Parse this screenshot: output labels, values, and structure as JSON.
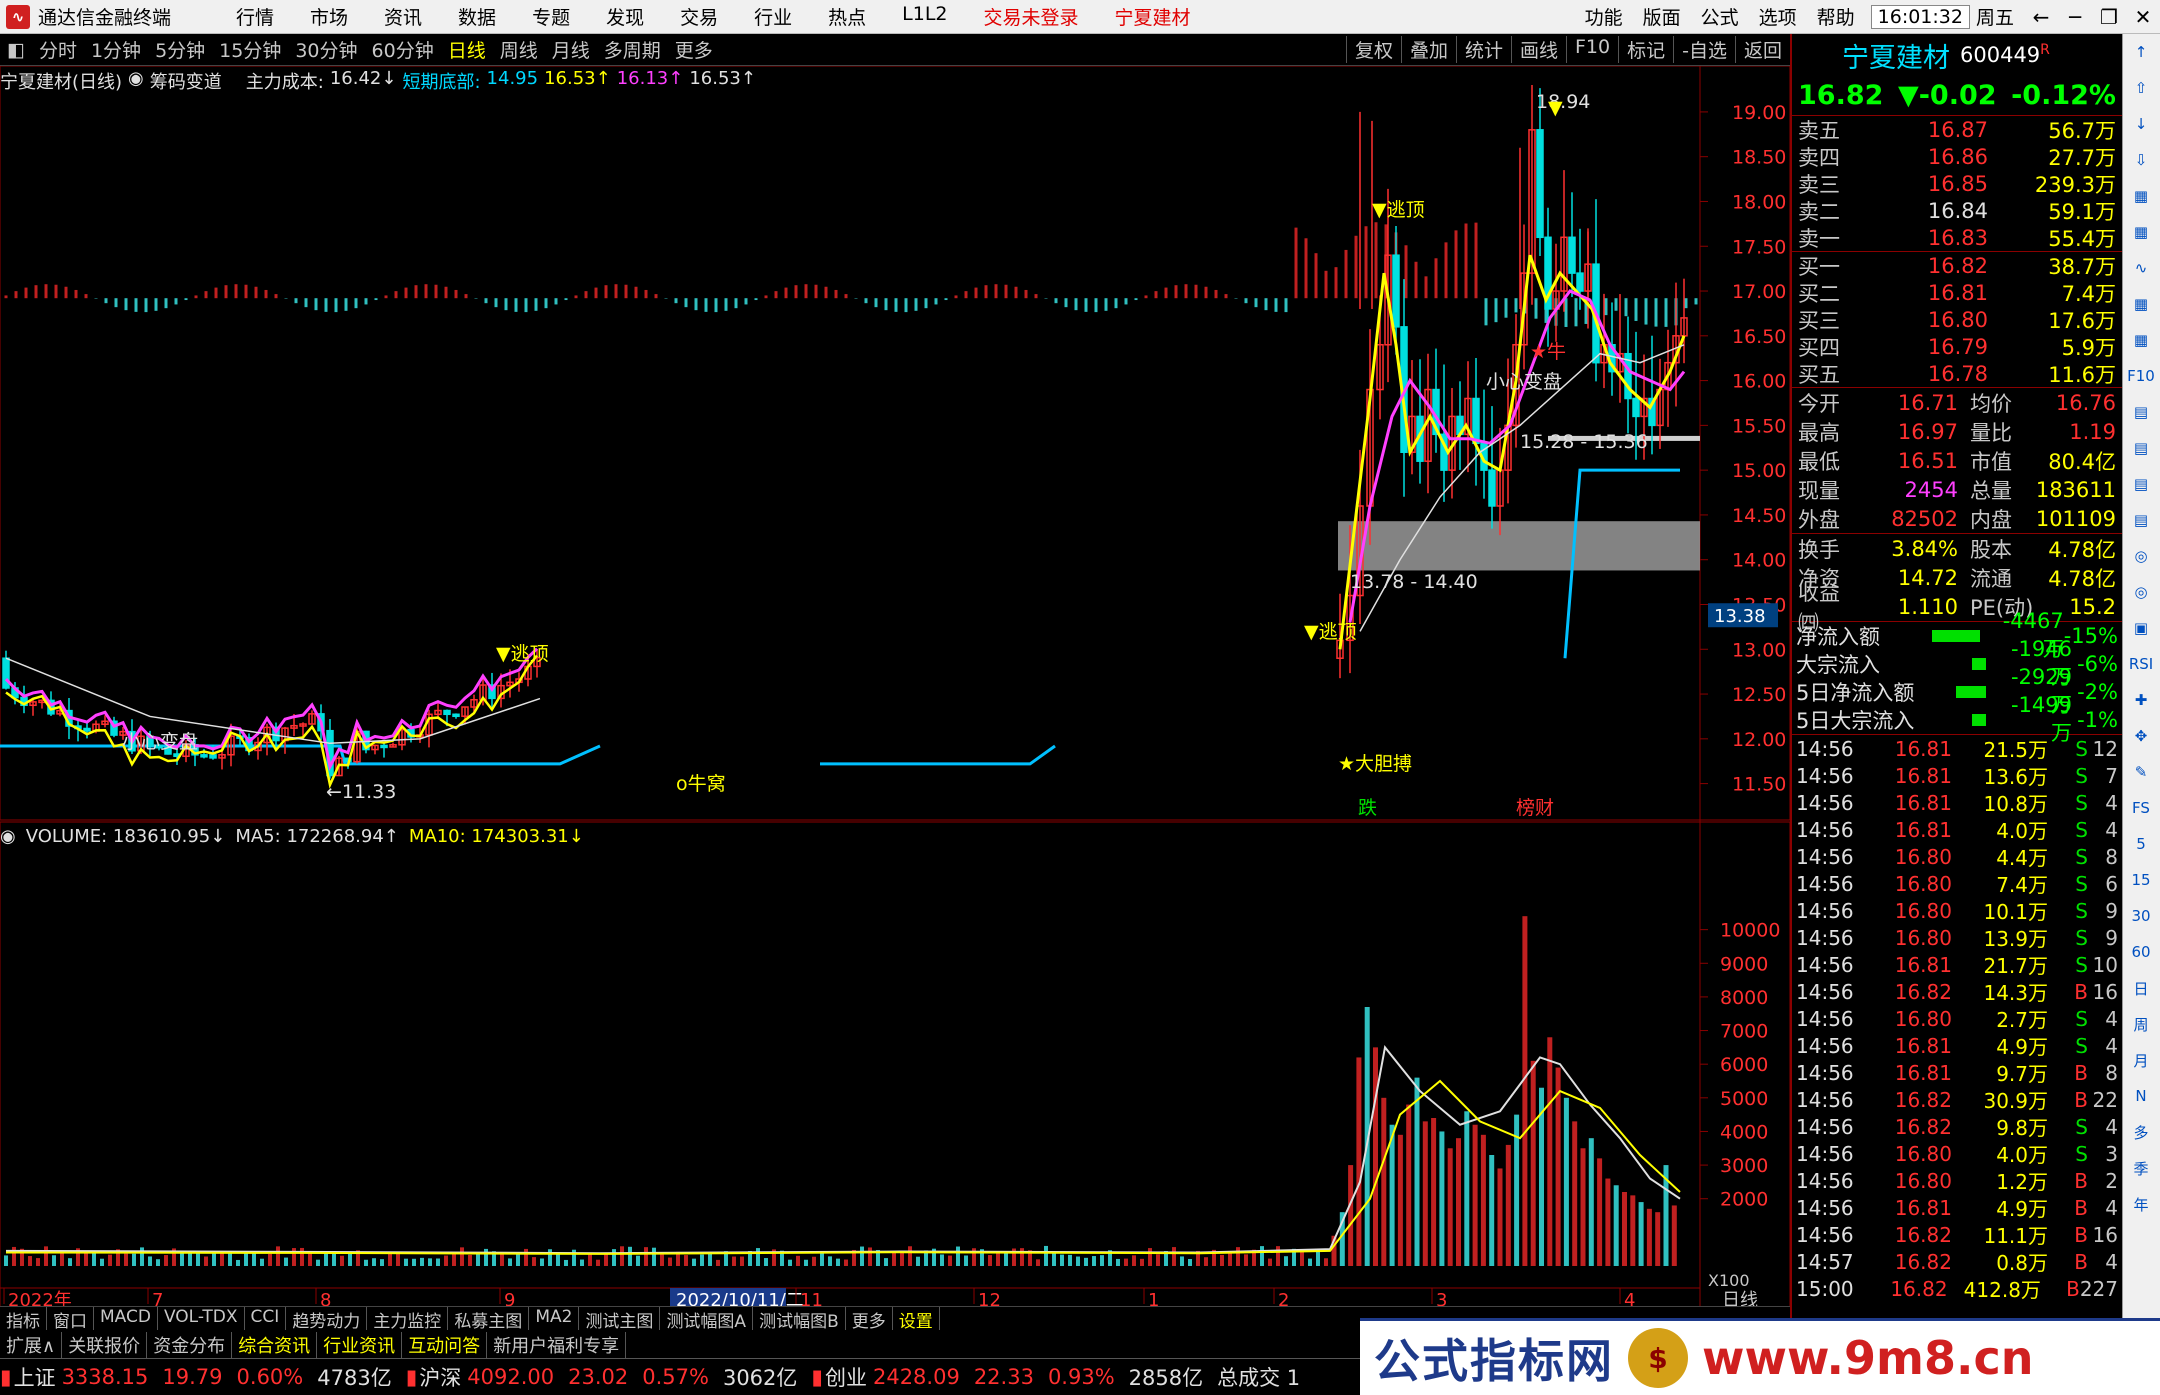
{
  "app": {
    "title": "通达信金融终端",
    "menu": [
      "行情",
      "市场",
      "资讯",
      "数据",
      "专题",
      "发现",
      "交易",
      "行业",
      "热点",
      "L1L2"
    ],
    "notice1": "交易未登录",
    "notice2": "宁夏建材",
    "right_menu": [
      "功能",
      "版面",
      "公式",
      "选项",
      "帮助"
    ],
    "clock": "16:01:32",
    "weekday": "周五",
    "win_btns": [
      "←",
      "─",
      "❐",
      "✕"
    ]
  },
  "toolbar": {
    "periods": [
      "分时",
      "1分钟",
      "5分钟",
      "15分钟",
      "30分钟",
      "60分钟",
      "日线",
      "周线",
      "月线",
      "多周期",
      "更多"
    ],
    "active": "日线",
    "right": [
      "复权",
      "叠加",
      "统计",
      "画线",
      "F10",
      "标记",
      "-自选",
      "返回"
    ]
  },
  "indicator_main": {
    "name": "宁夏建材(日线)",
    "sub": "筹码变道",
    "cost_label": "主力成本:",
    "cost": "16.42↓",
    "short_label": "短期底部:",
    "short": "14.95",
    "v2": "16.53↑",
    "v3": "16.13↑",
    "v4": "16.53↑"
  },
  "indicator_vol": {
    "label": "VOLUME:",
    "value": "183610.95↓",
    "ma5_label": "MA5:",
    "ma5": "172268.94↑",
    "ma10_label": "MA10:",
    "ma10": "174303.31↓"
  },
  "chart_data": {
    "type": "candlestick",
    "price_axis": [
      "19.00",
      "18.50",
      "18.00",
      "17.50",
      "17.00",
      "16.50",
      "16.00",
      "15.50",
      "15.00",
      "14.50",
      "14.00",
      "13.50",
      "13.00",
      "12.50",
      "12.00",
      "11.50"
    ],
    "price_ylim": [
      11.25,
      19.2
    ],
    "vol_axis": [
      "10000",
      "9000",
      "8000",
      "7000",
      "6000",
      "5000",
      "4000",
      "3000",
      "2000"
    ],
    "vol_ylim": [
      0,
      11000
    ],
    "vol_unit": "X100",
    "x_ticks": [
      "2022年",
      "7",
      "8",
      "9",
      "2022/10/11/二",
      "11",
      "12",
      "1",
      "2",
      "3",
      "4"
    ],
    "current_price_tag": "13.38",
    "annotations": [
      "小心变盘",
      "▼逃顶",
      "o牛窝",
      "▼逃顶",
      "★大胆搏",
      "▼逃顶",
      "小心变盘",
      "★牛",
      "18.94",
      "15.28 - 15.36",
      "13.78 - 14.40",
      "←11.33",
      "跌",
      "榜财"
    ],
    "period_label": "日线",
    "volume_bars_approx": [
      10400,
      7600,
      6400,
      6900,
      5600,
      5000,
      4800,
      4100,
      3400,
      3100,
      2600,
      2500,
      2000,
      1900
    ]
  },
  "quote": {
    "name": "宁夏建材",
    "code": "600449",
    "mark": "R",
    "price": "16.82",
    "change": "▼-0.02",
    "pct": "-0.12%",
    "asks": [
      {
        "l": "卖五",
        "p": "16.87",
        "v": "56.7万"
      },
      {
        "l": "卖四",
        "p": "16.86",
        "v": "27.7万"
      },
      {
        "l": "卖三",
        "p": "16.85",
        "v": "239.3万"
      },
      {
        "l": "卖二",
        "p": "16.84",
        "v": "59.1万"
      },
      {
        "l": "卖一",
        "p": "16.83",
        "v": "55.4万"
      }
    ],
    "bids": [
      {
        "l": "买一",
        "p": "16.82",
        "v": "38.7万"
      },
      {
        "l": "买二",
        "p": "16.81",
        "v": "7.4万"
      },
      {
        "l": "买三",
        "p": "16.80",
        "v": "17.6万"
      },
      {
        "l": "买四",
        "p": "16.79",
        "v": "5.9万"
      },
      {
        "l": "买五",
        "p": "16.78",
        "v": "11.6万"
      }
    ],
    "stats": [
      {
        "k": "今开",
        "v": "16.71",
        "k2": "均价",
        "v2": "16.76"
      },
      {
        "k": "最高",
        "v": "16.97",
        "k2": "量比",
        "v2": "1.19"
      },
      {
        "k": "最低",
        "v": "16.51",
        "k2": "市值",
        "v2": "80.4亿"
      },
      {
        "k": "现量",
        "v": "2454",
        "k2": "总量",
        "v2": "183611"
      },
      {
        "k": "外盘",
        "v": "82502",
        "k2": "内盘",
        "v2": "101109"
      }
    ],
    "stats2": [
      {
        "k": "换手",
        "v": "3.84%",
        "k2": "股本",
        "v2": "4.78亿"
      },
      {
        "k": "净资",
        "v": "14.72",
        "k2": "流通",
        "v2": "4.78亿"
      },
      {
        "k": "收益㈣",
        "v": "1.110",
        "k2": "PE(动)",
        "v2": "15.2"
      }
    ],
    "flows": [
      {
        "k": "净流入额",
        "v": "-4467万",
        "pct": "-15%"
      },
      {
        "k": "大宗流入",
        "v": "-1946万",
        "pct": "-6%"
      },
      {
        "k": "5日净流入额",
        "v": "-2929万",
        "pct": "-2%"
      },
      {
        "k": "5日大宗流入",
        "v": "-1499万",
        "pct": "-1%"
      }
    ],
    "ticks": [
      [
        "14:56",
        "16.81",
        "21.5万",
        "S",
        "12"
      ],
      [
        "14:56",
        "16.81",
        "13.6万",
        "S",
        "7"
      ],
      [
        "14:56",
        "16.81",
        "10.8万",
        "S",
        "4"
      ],
      [
        "14:56",
        "16.81",
        "4.0万",
        "S",
        "4"
      ],
      [
        "14:56",
        "16.80",
        "4.4万",
        "S",
        "8"
      ],
      [
        "14:56",
        "16.80",
        "7.4万",
        "S",
        "6"
      ],
      [
        "14:56",
        "16.80",
        "10.1万",
        "S",
        "9"
      ],
      [
        "14:56",
        "16.80",
        "13.9万",
        "S",
        "9"
      ],
      [
        "14:56",
        "16.81",
        "21.7万",
        "S",
        "10"
      ],
      [
        "14:56",
        "16.82",
        "14.3万",
        "B",
        "16"
      ],
      [
        "14:56",
        "16.80",
        "2.7万",
        "S",
        "4"
      ],
      [
        "14:56",
        "16.81",
        "4.9万",
        "S",
        "4"
      ],
      [
        "14:56",
        "16.81",
        "9.7万",
        "B",
        "8"
      ],
      [
        "14:56",
        "16.82",
        "30.9万",
        "B",
        "22"
      ],
      [
        "14:56",
        "16.82",
        "9.8万",
        "S",
        "4"
      ],
      [
        "14:56",
        "16.80",
        "4.0万",
        "S",
        "3"
      ],
      [
        "14:56",
        "16.80",
        "1.2万",
        "B",
        "2"
      ],
      [
        "14:56",
        "16.81",
        "4.9万",
        "B",
        "4"
      ],
      [
        "14:56",
        "16.82",
        "11.1万",
        "B",
        "16"
      ],
      [
        "14:57",
        "16.82",
        "0.8万",
        "B",
        "4"
      ],
      [
        "15:00",
        "16.82",
        "412.8万",
        "B",
        "227"
      ]
    ]
  },
  "sidebar": [
    "↑",
    "⇧",
    "↓",
    "⇩",
    "▦",
    "▦",
    "∿",
    "▦",
    "▦",
    "F10",
    "▤",
    "▤",
    "▤",
    "▤",
    "◎",
    "◎",
    "▣",
    "RSI",
    "✚",
    "✥",
    "✎",
    "FS",
    "5",
    "15",
    "30",
    "60",
    "日",
    "周",
    "月",
    "N",
    "多",
    "季",
    "年"
  ],
  "tabs1": [
    "指标",
    "窗口",
    "MACD",
    "VOL-TDX",
    "CCI",
    "趋势动力",
    "主力监控",
    "私募主图",
    "MA2",
    "测试主图",
    "测试幅图A",
    "测试幅图B",
    "更多",
    "设置"
  ],
  "tabs2": [
    "扩展∧",
    "关联报价",
    "资金分布",
    "综合资讯",
    "行业资讯",
    "互动问答",
    "新用户福利专享"
  ],
  "status": [
    {
      "n": "上证",
      "p": "3338.15",
      "c": "19.79",
      "pct": "0.60%",
      "a": "4783亿"
    },
    {
      "n": "沪深",
      "p": "4092.00",
      "c": "23.02",
      "pct": "0.57%",
      "a": "3062亿"
    },
    {
      "n": "创业",
      "p": "2428.09",
      "c": "22.33",
      "pct": "0.93%",
      "a": "2858亿"
    }
  ],
  "status_tail": "总成交 1",
  "banner": {
    "text": "公式指标网",
    "medal": "$",
    "url": "www.9m8.cn"
  }
}
